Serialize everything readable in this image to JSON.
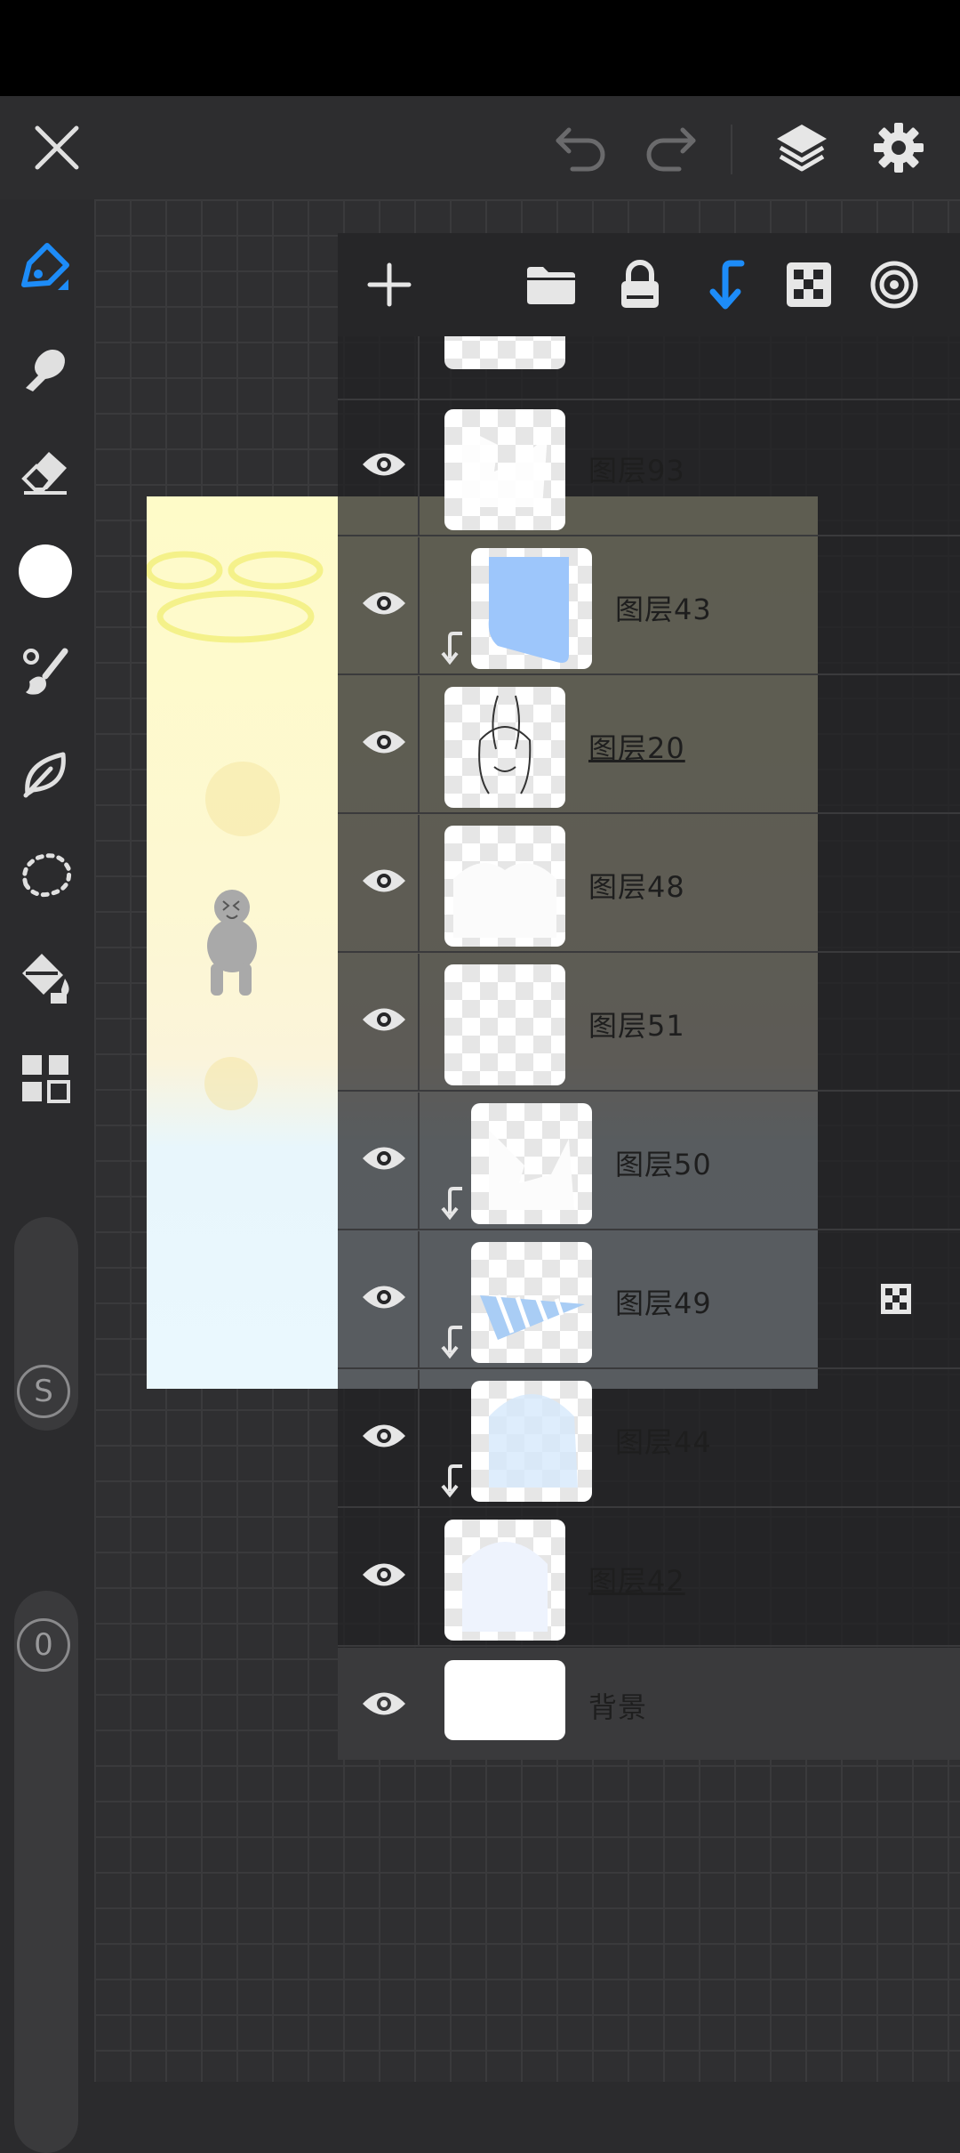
{
  "topbar": {
    "close": "close-icon",
    "undo": "undo-icon",
    "redo": "redo-icon",
    "layers": "layers-icon",
    "settings": "gear-icon"
  },
  "toolbar": {
    "tools": [
      "pen-tool-icon",
      "smudge-tool-icon",
      "eraser-tool-icon",
      "color-swatch-icon",
      "brush-settings-icon",
      "leaf-tool-icon",
      "lasso-select-icon",
      "fill-bucket-icon",
      "grid-apps-icon"
    ],
    "brush_size_label": "S",
    "opacity_label": "0",
    "accent_color": "#1d8cf8"
  },
  "layers_panel": {
    "header_icons": [
      "add-layer-icon",
      "folder-icon",
      "lock-icon",
      "clip-mask-icon",
      "transparency-lock-icon",
      "blend-mode-icon"
    ],
    "layers": [
      {
        "name": "图层93",
        "underline": false,
        "clipped": false
      },
      {
        "name": "图层43",
        "underline": false,
        "clipped": true
      },
      {
        "name": "图层20",
        "underline": true,
        "clipped": false
      },
      {
        "name": "图层48",
        "underline": false,
        "clipped": false
      },
      {
        "name": "图层51",
        "underline": false,
        "clipped": false
      },
      {
        "name": "图层50",
        "underline": false,
        "clipped": true
      },
      {
        "name": "图层49",
        "underline": false,
        "clipped": true
      },
      {
        "name": "图层44",
        "underline": false,
        "clipped": true
      },
      {
        "name": "图层42",
        "underline": true,
        "clipped": false
      }
    ],
    "background_layer": "背景"
  }
}
